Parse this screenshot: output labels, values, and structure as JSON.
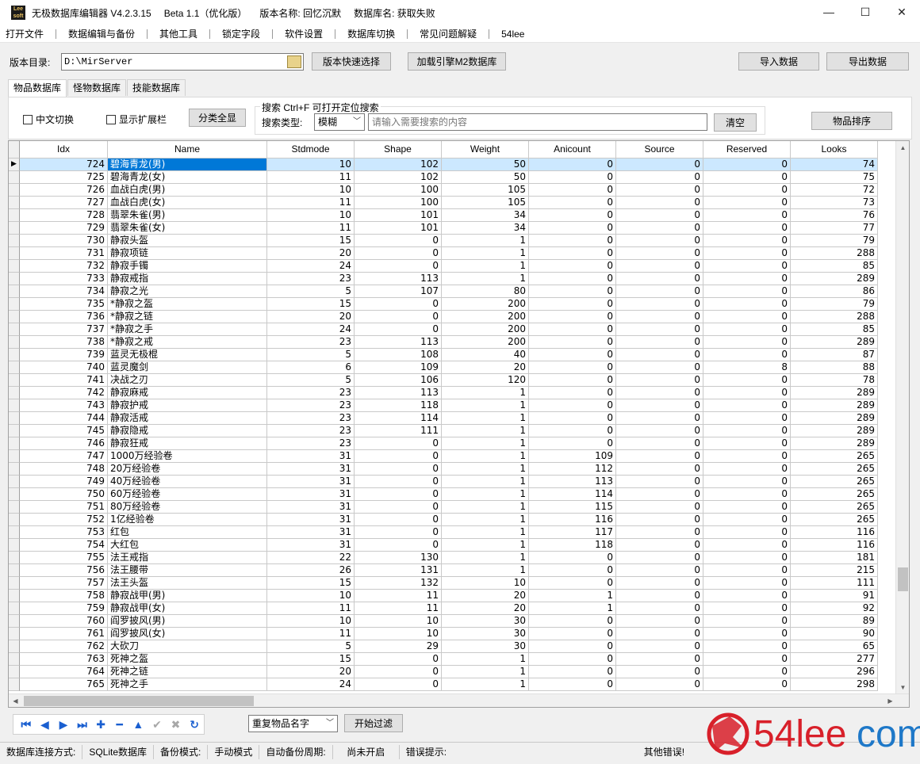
{
  "titlebar": {
    "logo_text": "Lee soft",
    "app_title": "无极数据库编辑器 V4.2.3.15",
    "beta": "Beta 1.1（优化版）",
    "version_name": "版本名称: 回忆沉默",
    "db_name": "数据库名: 获取失败",
    "minimize": "—",
    "maximize": "☐",
    "close": "✕"
  },
  "menu": [
    "打开文件",
    "数据编辑与备份",
    "其他工具",
    "锁定字段",
    "软件设置",
    "数据库切换",
    "常见问题解疑",
    "54lee"
  ],
  "toolbar": {
    "dir_label": "版本目录:",
    "dir_value": "D:\\MirServer",
    "quick_select": "版本快速选择",
    "load_m2": "加载引擎M2数据库",
    "import": "导入数据",
    "export": "导出数据"
  },
  "tabs": [
    "物品数据库",
    "怪物数据库",
    "技能数据库"
  ],
  "panel": {
    "cn_switch": "中文切换",
    "show_ext": "显示扩展栏",
    "show_all": "分类全显",
    "search_legend": "搜索  Ctrl+F 可打开定位搜索",
    "search_type_label": "搜索类型:",
    "search_type_value": "模糊",
    "search_placeholder": "请输入需要搜索的内容",
    "clear": "清空",
    "sort": "物品排序"
  },
  "grid": {
    "columns": [
      "Idx",
      "Name",
      "Stdmode",
      "Shape",
      "Weight",
      "Anicount",
      "Source",
      "Reserved",
      "Looks"
    ],
    "selected_index": 0,
    "rows": [
      [
        "724",
        "碧海青龙(男)",
        "10",
        "102",
        "50",
        "0",
        "0",
        "0",
        "74"
      ],
      [
        "725",
        "碧海青龙(女)",
        "11",
        "102",
        "50",
        "0",
        "0",
        "0",
        "75"
      ],
      [
        "726",
        "血战白虎(男)",
        "10",
        "100",
        "105",
        "0",
        "0",
        "0",
        "72"
      ],
      [
        "727",
        "血战白虎(女)",
        "11",
        "100",
        "105",
        "0",
        "0",
        "0",
        "73"
      ],
      [
        "728",
        "翡翠朱雀(男)",
        "10",
        "101",
        "34",
        "0",
        "0",
        "0",
        "76"
      ],
      [
        "729",
        "翡翠朱雀(女)",
        "11",
        "101",
        "34",
        "0",
        "0",
        "0",
        "77"
      ],
      [
        "730",
        "静寂头盔",
        "15",
        "0",
        "1",
        "0",
        "0",
        "0",
        "79"
      ],
      [
        "731",
        "静寂项链",
        "20",
        "0",
        "1",
        "0",
        "0",
        "0",
        "288"
      ],
      [
        "732",
        "静寂手镯",
        "24",
        "0",
        "1",
        "0",
        "0",
        "0",
        "85"
      ],
      [
        "733",
        "静寂戒指",
        "23",
        "113",
        "1",
        "0",
        "0",
        "0",
        "289"
      ],
      [
        "734",
        "静寂之光",
        "5",
        "107",
        "80",
        "0",
        "0",
        "0",
        "86"
      ],
      [
        "735",
        "*静寂之盔",
        "15",
        "0",
        "200",
        "0",
        "0",
        "0",
        "79"
      ],
      [
        "736",
        "*静寂之链",
        "20",
        "0",
        "200",
        "0",
        "0",
        "0",
        "288"
      ],
      [
        "737",
        "*静寂之手",
        "24",
        "0",
        "200",
        "0",
        "0",
        "0",
        "85"
      ],
      [
        "738",
        "*静寂之戒",
        "23",
        "113",
        "200",
        "0",
        "0",
        "0",
        "289"
      ],
      [
        "739",
        "蓝灵无极棍",
        "5",
        "108",
        "40",
        "0",
        "0",
        "0",
        "87"
      ],
      [
        "740",
        "蓝灵魔剑",
        "6",
        "109",
        "20",
        "0",
        "0",
        "8",
        "88"
      ],
      [
        "741",
        "决战之刃",
        "5",
        "106",
        "120",
        "0",
        "0",
        "0",
        "78"
      ],
      [
        "742",
        "静寂麻戒",
        "23",
        "113",
        "1",
        "0",
        "0",
        "0",
        "289"
      ],
      [
        "743",
        "静寂护戒",
        "23",
        "118",
        "1",
        "0",
        "0",
        "0",
        "289"
      ],
      [
        "744",
        "静寂活戒",
        "23",
        "114",
        "1",
        "0",
        "0",
        "0",
        "289"
      ],
      [
        "745",
        "静寂隐戒",
        "23",
        "111",
        "1",
        "0",
        "0",
        "0",
        "289"
      ],
      [
        "746",
        "静寂狂戒",
        "23",
        "0",
        "1",
        "0",
        "0",
        "0",
        "289"
      ],
      [
        "747",
        "1000万经验卷",
        "31",
        "0",
        "1",
        "109",
        "0",
        "0",
        "265"
      ],
      [
        "748",
        "20万经验卷",
        "31",
        "0",
        "1",
        "112",
        "0",
        "0",
        "265"
      ],
      [
        "749",
        "40万经验卷",
        "31",
        "0",
        "1",
        "113",
        "0",
        "0",
        "265"
      ],
      [
        "750",
        "60万经验卷",
        "31",
        "0",
        "1",
        "114",
        "0",
        "0",
        "265"
      ],
      [
        "751",
        "80万经验卷",
        "31",
        "0",
        "1",
        "115",
        "0",
        "0",
        "265"
      ],
      [
        "752",
        "1亿经验卷",
        "31",
        "0",
        "1",
        "116",
        "0",
        "0",
        "265"
      ],
      [
        "753",
        "红包",
        "31",
        "0",
        "1",
        "117",
        "0",
        "0",
        "116"
      ],
      [
        "754",
        "大红包",
        "31",
        "0",
        "1",
        "118",
        "0",
        "0",
        "116"
      ],
      [
        "755",
        "法王戒指",
        "22",
        "130",
        "1",
        "0",
        "0",
        "0",
        "181"
      ],
      [
        "756",
        "法王腰带",
        "26",
        "131",
        "1",
        "0",
        "0",
        "0",
        "215"
      ],
      [
        "757",
        "法王头盔",
        "15",
        "132",
        "10",
        "0",
        "0",
        "0",
        "111"
      ],
      [
        "758",
        "静寂战甲(男)",
        "10",
        "11",
        "20",
        "1",
        "0",
        "0",
        "91"
      ],
      [
        "759",
        "静寂战甲(女)",
        "11",
        "11",
        "20",
        "1",
        "0",
        "0",
        "92"
      ],
      [
        "760",
        "阎罗披风(男)",
        "10",
        "10",
        "30",
        "0",
        "0",
        "0",
        "89"
      ],
      [
        "761",
        "阎罗披风(女)",
        "11",
        "10",
        "30",
        "0",
        "0",
        "0",
        "90"
      ],
      [
        "762",
        "大砍刀",
        "5",
        "29",
        "30",
        "0",
        "0",
        "0",
        "65"
      ],
      [
        "763",
        "死神之盔",
        "15",
        "0",
        "1",
        "0",
        "0",
        "0",
        "277"
      ],
      [
        "764",
        "死神之链",
        "20",
        "0",
        "1",
        "0",
        "0",
        "0",
        "296"
      ],
      [
        "765",
        "死神之手",
        "24",
        "0",
        "1",
        "0",
        "0",
        "0",
        "298"
      ]
    ]
  },
  "bottom": {
    "nav_icons": [
      "first-icon",
      "prior-icon",
      "next-icon",
      "last-icon",
      "insert-icon",
      "delete-icon",
      "edit-icon",
      "post-icon",
      "cancel-icon",
      "refresh-icon"
    ],
    "dup_select": "重复物品名字",
    "start_filter": "开始过滤"
  },
  "status": {
    "conn_label": "数据库连接方式:",
    "conn_value": "SQLite数据库",
    "backup_label": "备份模式:",
    "backup_value": "手动模式",
    "auto_label": "自动备份周期:",
    "auto_value": "尚未开启",
    "error_label": "错误提示:",
    "other_error": "其他错误!"
  },
  "watermark": {
    "text": "54leecom",
    "colors": {
      "red": "#d8202a",
      "blue": "#1e78c8"
    }
  }
}
